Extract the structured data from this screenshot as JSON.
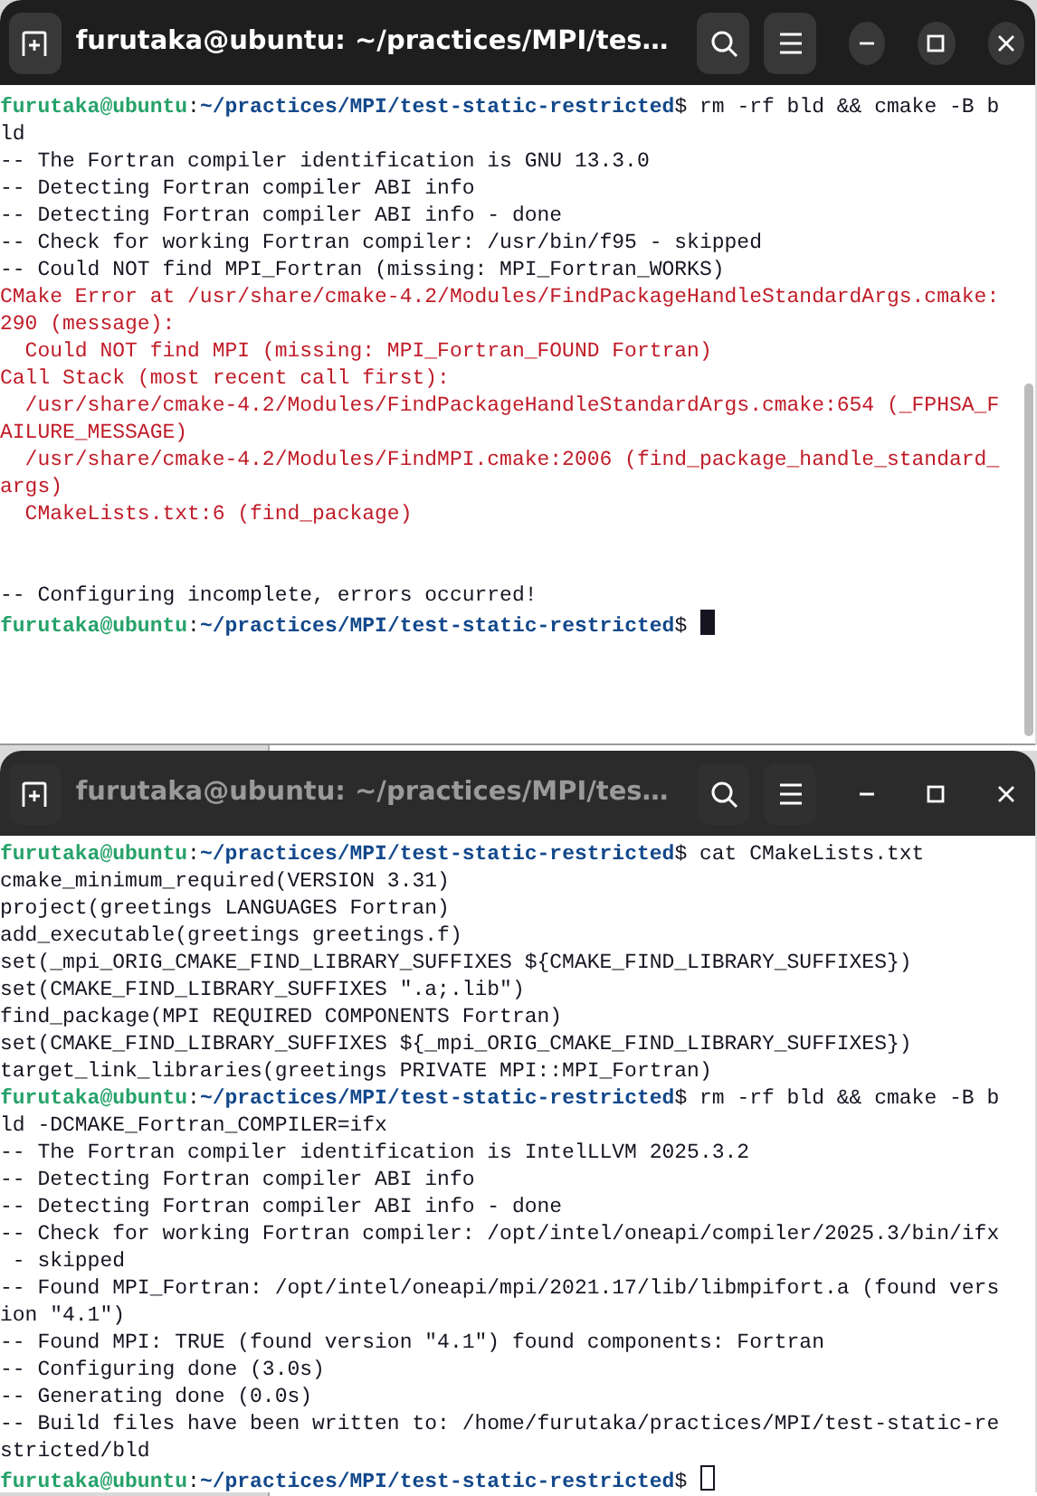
{
  "windows": [
    {
      "title": "furutaka@ubuntu: ~/practices/MPI/tes…",
      "focused": true,
      "scrollbar": true,
      "lines": [
        {
          "kind": "text",
          "segments": [
            {
              "kind": "user",
              "text": "furutaka@ubuntu"
            },
            {
              "kind": "plain",
              "text": ":"
            },
            {
              "kind": "path",
              "text": "~/practices/MPI/test-static-restricted"
            },
            {
              "kind": "plain",
              "text": "$ rm -rf bld && cmake -B b"
            }
          ]
        },
        {
          "kind": "text",
          "segments": [
            {
              "kind": "plain",
              "text": "ld"
            }
          ]
        },
        {
          "kind": "text",
          "segments": [
            {
              "kind": "plain",
              "text": "-- The Fortran compiler identification is GNU 13.3.0"
            }
          ]
        },
        {
          "kind": "text",
          "segments": [
            {
              "kind": "plain",
              "text": "-- Detecting Fortran compiler ABI info"
            }
          ]
        },
        {
          "kind": "text",
          "segments": [
            {
              "kind": "plain",
              "text": "-- Detecting Fortran compiler ABI info - done"
            }
          ]
        },
        {
          "kind": "text",
          "segments": [
            {
              "kind": "plain",
              "text": "-- Check for working Fortran compiler: /usr/bin/f95 - skipped"
            }
          ]
        },
        {
          "kind": "text",
          "segments": [
            {
              "kind": "plain",
              "text": "-- Could NOT find MPI_Fortran (missing: MPI_Fortran_WORKS)"
            }
          ]
        },
        {
          "kind": "text",
          "segments": [
            {
              "kind": "error",
              "text": "CMake Error at /usr/share/cmake-4.2/Modules/FindPackageHandleStandardArgs.cmake:"
            }
          ]
        },
        {
          "kind": "text",
          "segments": [
            {
              "kind": "error",
              "text": "290 (message):"
            }
          ]
        },
        {
          "kind": "text",
          "segments": [
            {
              "kind": "error",
              "text": "  Could NOT find MPI (missing: MPI_Fortran_FOUND Fortran)"
            }
          ]
        },
        {
          "kind": "text",
          "segments": [
            {
              "kind": "error",
              "text": "Call Stack (most recent call first):"
            }
          ]
        },
        {
          "kind": "text",
          "segments": [
            {
              "kind": "error",
              "text": "  /usr/share/cmake-4.2/Modules/FindPackageHandleStandardArgs.cmake:654 (_FPHSA_F"
            }
          ]
        },
        {
          "kind": "text",
          "segments": [
            {
              "kind": "error",
              "text": "AILURE_MESSAGE)"
            }
          ]
        },
        {
          "kind": "text",
          "segments": [
            {
              "kind": "error",
              "text": "  /usr/share/cmake-4.2/Modules/FindMPI.cmake:2006 (find_package_handle_standard_"
            }
          ]
        },
        {
          "kind": "text",
          "segments": [
            {
              "kind": "error",
              "text": "args)"
            }
          ]
        },
        {
          "kind": "text",
          "segments": [
            {
              "kind": "error",
              "text": "  CMakeLists.txt:6 (find_package)"
            }
          ]
        },
        {
          "kind": "blank"
        },
        {
          "kind": "blank"
        },
        {
          "kind": "text",
          "segments": [
            {
              "kind": "plain",
              "text": "-- Configuring incomplete, errors occurred!"
            }
          ]
        },
        {
          "kind": "text",
          "cursor": true,
          "segments": [
            {
              "kind": "user",
              "text": "furutaka@ubuntu"
            },
            {
              "kind": "plain",
              "text": ":"
            },
            {
              "kind": "path",
              "text": "~/practices/MPI/test-static-restricted"
            },
            {
              "kind": "plain",
              "text": "$ "
            }
          ]
        }
      ]
    },
    {
      "title": "furutaka@ubuntu: ~/practices/MPI/tes…",
      "focused": false,
      "scrollbar": false,
      "lines": [
        {
          "kind": "text",
          "segments": [
            {
              "kind": "user",
              "text": "furutaka@ubuntu"
            },
            {
              "kind": "plain",
              "text": ":"
            },
            {
              "kind": "path",
              "text": "~/practices/MPI/test-static-restricted"
            },
            {
              "kind": "plain",
              "text": "$ cat CMakeLists.txt"
            }
          ]
        },
        {
          "kind": "text",
          "segments": [
            {
              "kind": "plain",
              "text": "cmake_minimum_required(VERSION 3.31)"
            }
          ]
        },
        {
          "kind": "text",
          "segments": [
            {
              "kind": "plain",
              "text": "project(greetings LANGUAGES Fortran)"
            }
          ]
        },
        {
          "kind": "text",
          "segments": [
            {
              "kind": "plain",
              "text": "add_executable(greetings greetings.f)"
            }
          ]
        },
        {
          "kind": "text",
          "segments": [
            {
              "kind": "plain",
              "text": "set(_mpi_ORIG_CMAKE_FIND_LIBRARY_SUFFIXES ${CMAKE_FIND_LIBRARY_SUFFIXES})"
            }
          ]
        },
        {
          "kind": "text",
          "segments": [
            {
              "kind": "plain",
              "text": "set(CMAKE_FIND_LIBRARY_SUFFIXES \".a;.lib\")"
            }
          ]
        },
        {
          "kind": "text",
          "segments": [
            {
              "kind": "plain",
              "text": "find_package(MPI REQUIRED COMPONENTS Fortran)"
            }
          ]
        },
        {
          "kind": "text",
          "segments": [
            {
              "kind": "plain",
              "text": "set(CMAKE_FIND_LIBRARY_SUFFIXES ${_mpi_ORIG_CMAKE_FIND_LIBRARY_SUFFIXES})"
            }
          ]
        },
        {
          "kind": "text",
          "segments": [
            {
              "kind": "plain",
              "text": "target_link_libraries(greetings PRIVATE MPI::MPI_Fortran)"
            }
          ]
        },
        {
          "kind": "text",
          "segments": [
            {
              "kind": "user",
              "text": "furutaka@ubuntu"
            },
            {
              "kind": "plain",
              "text": ":"
            },
            {
              "kind": "path",
              "text": "~/practices/MPI/test-static-restricted"
            },
            {
              "kind": "plain",
              "text": "$ rm -rf bld && cmake -B b"
            }
          ]
        },
        {
          "kind": "text",
          "segments": [
            {
              "kind": "plain",
              "text": "ld -DCMAKE_Fortran_COMPILER=ifx"
            }
          ]
        },
        {
          "kind": "text",
          "segments": [
            {
              "kind": "plain",
              "text": "-- The Fortran compiler identification is IntelLLVM 2025.3.2"
            }
          ]
        },
        {
          "kind": "text",
          "segments": [
            {
              "kind": "plain",
              "text": "-- Detecting Fortran compiler ABI info"
            }
          ]
        },
        {
          "kind": "text",
          "segments": [
            {
              "kind": "plain",
              "text": "-- Detecting Fortran compiler ABI info - done"
            }
          ]
        },
        {
          "kind": "text",
          "segments": [
            {
              "kind": "plain",
              "text": "-- Check for working Fortran compiler: /opt/intel/oneapi/compiler/2025.3/bin/ifx"
            }
          ]
        },
        {
          "kind": "text",
          "segments": [
            {
              "kind": "plain",
              "text": " - skipped"
            }
          ]
        },
        {
          "kind": "text",
          "segments": [
            {
              "kind": "plain",
              "text": "-- Found MPI_Fortran: /opt/intel/oneapi/mpi/2021.17/lib/libmpifort.a (found vers"
            }
          ]
        },
        {
          "kind": "text",
          "segments": [
            {
              "kind": "plain",
              "text": "ion \"4.1\")"
            }
          ]
        },
        {
          "kind": "text",
          "segments": [
            {
              "kind": "plain",
              "text": "-- Found MPI: TRUE (found version \"4.1\") found components: Fortran"
            }
          ]
        },
        {
          "kind": "text",
          "segments": [
            {
              "kind": "plain",
              "text": "-- Configuring done (3.0s)"
            }
          ]
        },
        {
          "kind": "text",
          "segments": [
            {
              "kind": "plain",
              "text": "-- Generating done (0.0s)"
            }
          ]
        },
        {
          "kind": "text",
          "segments": [
            {
              "kind": "plain",
              "text": "-- Build files have been written to: /home/furutaka/practices/MPI/test-static-re"
            }
          ]
        },
        {
          "kind": "text",
          "segments": [
            {
              "kind": "plain",
              "text": "stricted/bld"
            }
          ]
        },
        {
          "kind": "text",
          "cursor": true,
          "segments": [
            {
              "kind": "user",
              "text": "furutaka@ubuntu"
            },
            {
              "kind": "plain",
              "text": ":"
            },
            {
              "kind": "path",
              "text": "~/practices/MPI/test-static-restricted"
            },
            {
              "kind": "plain",
              "text": "$ "
            }
          ]
        }
      ]
    }
  ]
}
